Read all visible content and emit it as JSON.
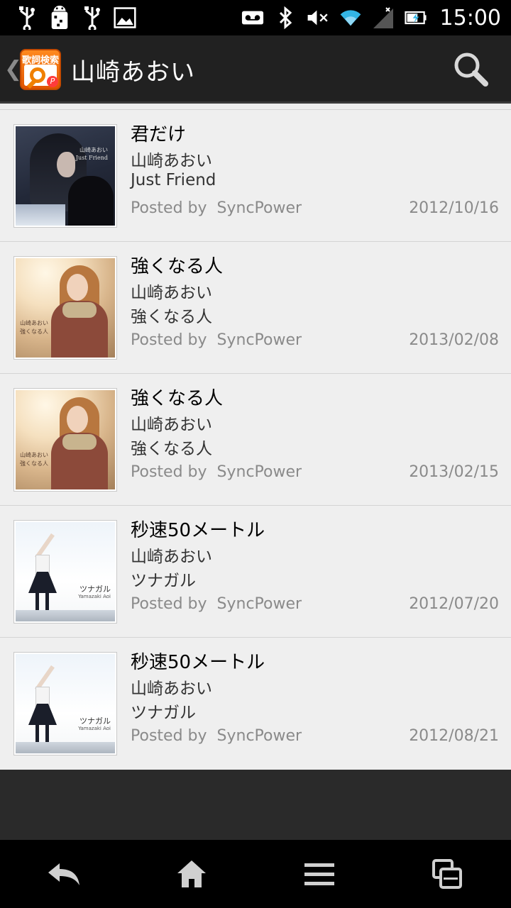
{
  "status_bar": {
    "time": "15:00",
    "left_icons": [
      "usb-icon",
      "android-debug-icon",
      "usb-icon",
      "image-icon"
    ],
    "right_icons": [
      "voicemail-icon",
      "bluetooth-icon",
      "mute-icon",
      "wifi-icon",
      "signal-icon",
      "battery-charging-icon"
    ]
  },
  "action_bar": {
    "back_chevron": "❮",
    "app_icon_text": "歌詞検索",
    "app_icon_badge": "P",
    "title": "山崎あおい"
  },
  "songs": [
    {
      "title": "君だけ",
      "artist": "山崎あおい",
      "album": "Just Friend",
      "posted_label": "Posted by",
      "poster": "SyncPower",
      "date": "2012/10/16",
      "art_caption_1": "山崎あおい",
      "art_caption_2": "Just Friend"
    },
    {
      "title": "強くなる人",
      "artist": "山崎あおい",
      "album": "強くなる人",
      "posted_label": "Posted by",
      "poster": "SyncPower",
      "date": "2013/02/08",
      "art_caption_1": "山崎あおい",
      "art_caption_2": "強くなる人"
    },
    {
      "title": "強くなる人",
      "artist": "山崎あおい",
      "album": "強くなる人",
      "posted_label": "Posted by",
      "poster": "SyncPower",
      "date": "2013/02/15",
      "art_caption_1": "山崎あおい",
      "art_caption_2": "強くなる人"
    },
    {
      "title": "秒速50メートル",
      "artist": "山崎あおい",
      "album": "ツナガル",
      "posted_label": "Posted by",
      "poster": "SyncPower",
      "date": "2012/07/20",
      "art_caption_1": "ツナガル",
      "art_caption_2": "Yamazaki Aoi"
    },
    {
      "title": "秒速50メートル",
      "artist": "山崎あおい",
      "album": "ツナガル",
      "posted_label": "Posted by",
      "poster": "SyncPower",
      "date": "2012/08/21",
      "art_caption_1": "ツナガル",
      "art_caption_2": "Yamazaki Aoi"
    }
  ],
  "nav_bar": {
    "icons": [
      "back-icon",
      "home-icon",
      "menu-icon",
      "recent-apps-icon"
    ]
  },
  "colors": {
    "action_bar_bg": "#212121",
    "list_bg": "#efefef",
    "app_icon_orange": "#f08000"
  }
}
